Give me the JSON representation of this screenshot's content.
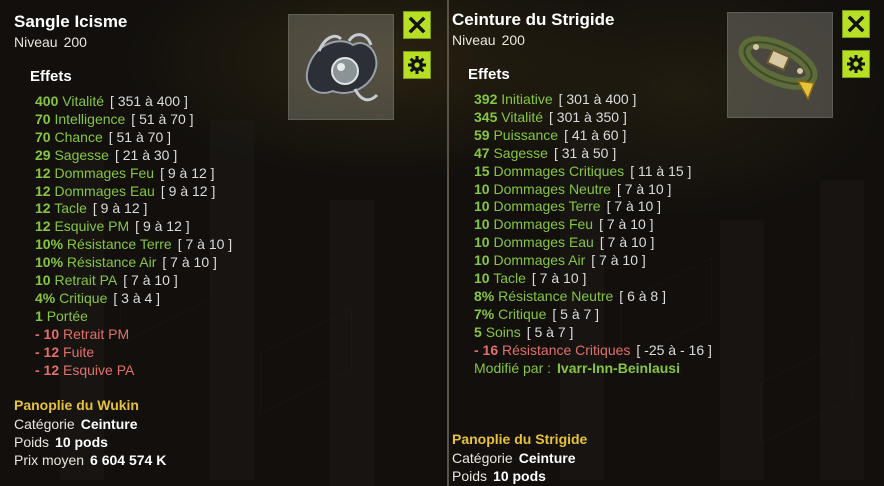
{
  "left_item": {
    "name": "Sangle Icisme",
    "level_label": "Niveau",
    "level_value": "200",
    "effects_title": "Effets",
    "effects": [
      {
        "value": "400",
        "name": "Vitalité",
        "range": "[ 351 à 400 ]",
        "tone": "g"
      },
      {
        "value": "70",
        "name": "Intelligence",
        "range": "[ 51 à 70 ]",
        "tone": "g"
      },
      {
        "value": "70",
        "name": "Chance",
        "range": "[ 51 à 70 ]",
        "tone": "g"
      },
      {
        "value": "29",
        "name": "Sagesse",
        "range": "[ 21 à 30 ]",
        "tone": "g"
      },
      {
        "value": "12",
        "name": "Dommages Feu",
        "range": "[ 9 à 12 ]",
        "tone": "g"
      },
      {
        "value": "12",
        "name": "Dommages Eau",
        "range": "[ 9 à 12 ]",
        "tone": "g"
      },
      {
        "value": "12",
        "name": "Tacle",
        "range": "[ 9 à 12 ]",
        "tone": "g"
      },
      {
        "value": "12",
        "name": "Esquive PM",
        "range": "[ 9 à 12 ]",
        "tone": "g"
      },
      {
        "value": "10%",
        "name": "Résistance Terre",
        "range": "[ 7 à 10 ]",
        "tone": "g"
      },
      {
        "value": "10%",
        "name": "Résistance Air",
        "range": "[ 7 à 10 ]",
        "tone": "g"
      },
      {
        "value": "10",
        "name": "Retrait PA",
        "range": "[ 7 à 10 ]",
        "tone": "g"
      },
      {
        "value": "4%",
        "name": "Critique",
        "range": "[ 3 à 4 ]",
        "tone": "g"
      },
      {
        "value": "1",
        "name": "Portée",
        "range": "",
        "tone": "g"
      },
      {
        "value": "- 10",
        "name": "Retrait PM",
        "range": "",
        "tone": "r"
      },
      {
        "value": "- 12",
        "name": "Fuite",
        "range": "",
        "tone": "r"
      },
      {
        "value": "- 12",
        "name": "Esquive PA",
        "range": "",
        "tone": "r"
      }
    ],
    "set_name": "Panoplie du Wukin",
    "category_label": "Catégorie",
    "category_value": "Ceinture",
    "weight_label": "Poids",
    "weight_value": "10 pods",
    "price_label": "Prix moyen",
    "price_value": "6 604 574 K"
  },
  "right_item": {
    "name": "Ceinture du Strigide",
    "level_label": "Niveau",
    "level_value": "200",
    "effects_title": "Effets",
    "effects": [
      {
        "value": "392",
        "name": "Initiative",
        "range": "[ 301 à 400 ]",
        "tone": "g"
      },
      {
        "value": "345",
        "name": "Vitalité",
        "range": "[ 301 à 350 ]",
        "tone": "g"
      },
      {
        "value": "59",
        "name": "Puissance",
        "range": "[ 41 à 60 ]",
        "tone": "g"
      },
      {
        "value": "47",
        "name": "Sagesse",
        "range": "[ 31 à 50 ]",
        "tone": "g"
      },
      {
        "value": "15",
        "name": "Dommages Critiques",
        "range": "[ 11 à 15 ]",
        "tone": "g"
      },
      {
        "value": "10",
        "name": "Dommages Neutre",
        "range": "[ 7 à 10 ]",
        "tone": "g"
      },
      {
        "value": "10",
        "name": "Dommages Terre",
        "range": "[ 7 à 10 ]",
        "tone": "g"
      },
      {
        "value": "10",
        "name": "Dommages Feu",
        "range": "[ 7 à 10 ]",
        "tone": "g"
      },
      {
        "value": "10",
        "name": "Dommages Eau",
        "range": "[ 7 à 10 ]",
        "tone": "g"
      },
      {
        "value": "10",
        "name": "Dommages Air",
        "range": "[ 7 à 10 ]",
        "tone": "g"
      },
      {
        "value": "10",
        "name": "Tacle",
        "range": "[ 7 à 10 ]",
        "tone": "g"
      },
      {
        "value": "8%",
        "name": "Résistance Neutre",
        "range": "[ 6 à 8 ]",
        "tone": "g"
      },
      {
        "value": "7%",
        "name": "Critique",
        "range": "[ 5 à 7 ]",
        "tone": "g"
      },
      {
        "value": "5",
        "name": "Soins",
        "range": "[ 5 à 7 ]",
        "tone": "g"
      },
      {
        "value": "- 16",
        "name": "Résistance Critiques",
        "range": "[ -25 à - 16 ]",
        "tone": "r"
      }
    ],
    "modified_label": "Modifié par :",
    "modified_by": "Ivarr-Inn-Beinlausi",
    "set_name": "Panoplie du Strigide",
    "category_label": "Catégorie",
    "category_value": "Ceinture",
    "weight_label": "Poids",
    "weight_value": "10 pods"
  },
  "icons": {
    "close": "close-x-icon",
    "settings": "gear-icon"
  },
  "colors": {
    "positive": "#86c541",
    "negative": "#e0706a",
    "set": "#e6c23a",
    "button": "#b7df24"
  }
}
